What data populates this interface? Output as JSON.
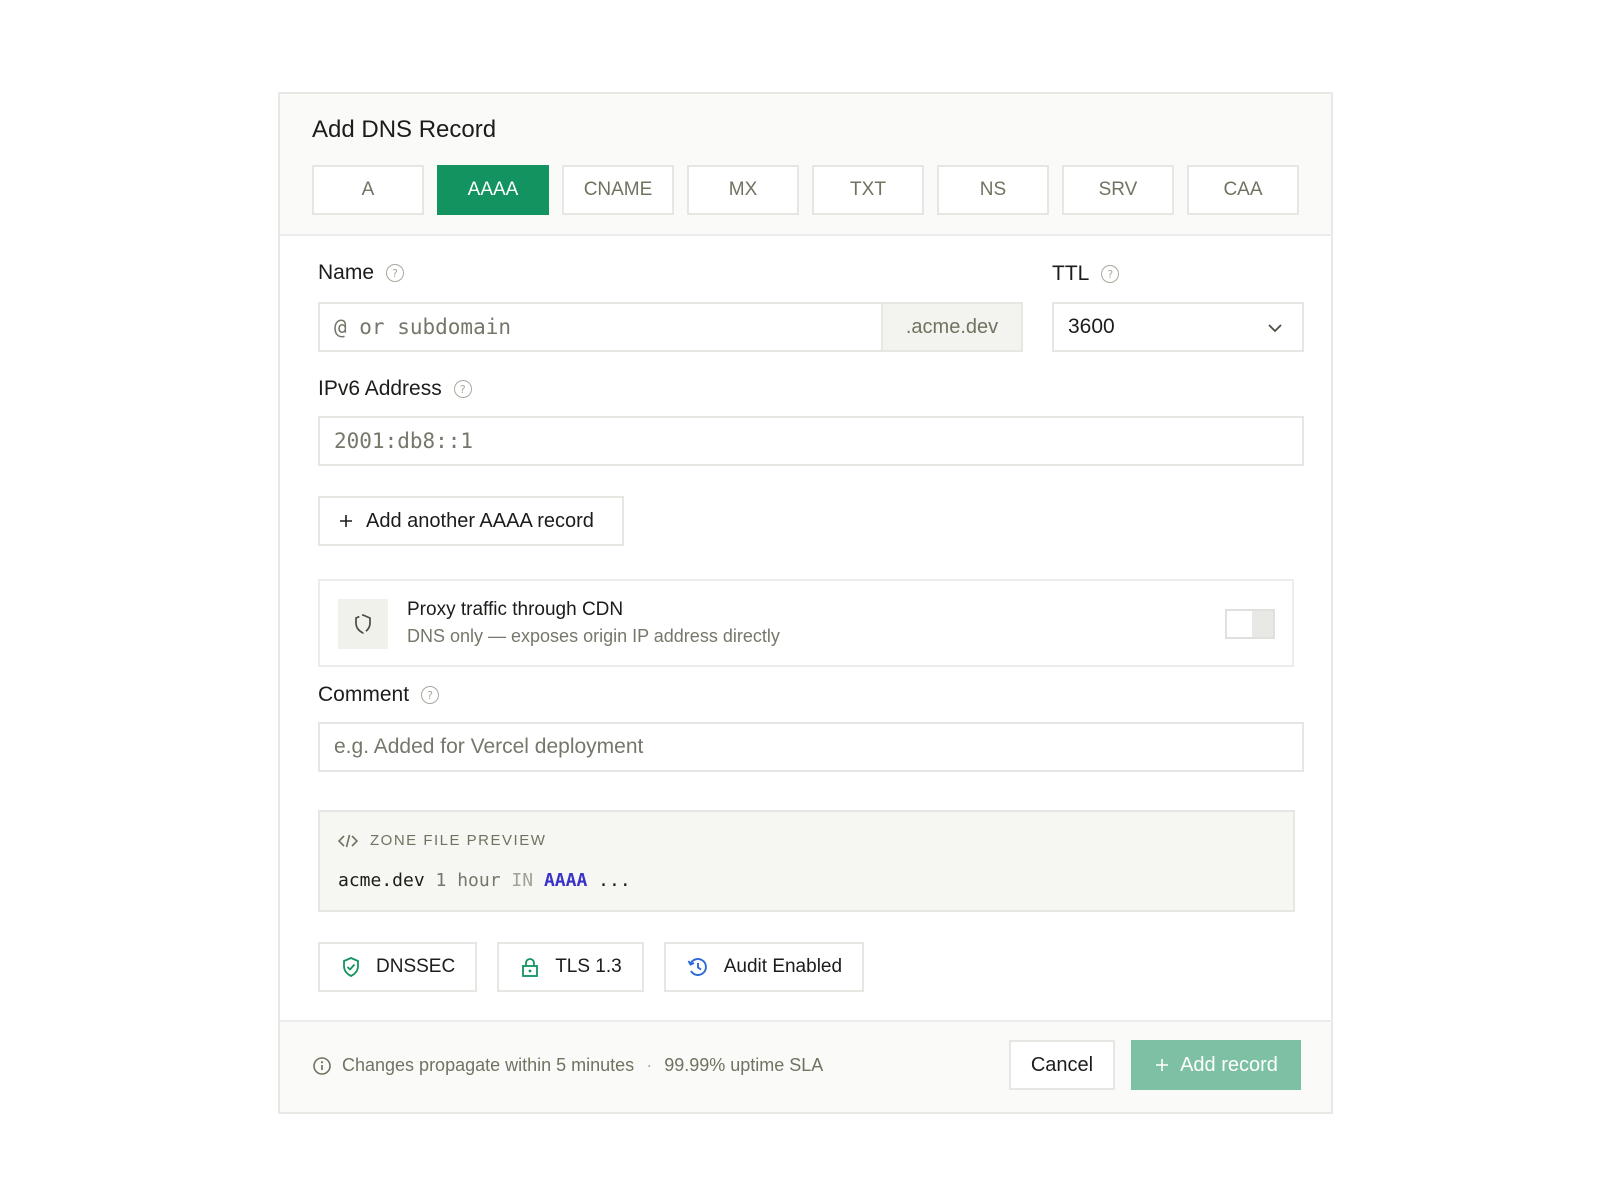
{
  "dialog": {
    "title": "Add DNS Record",
    "record_types": [
      "A",
      "AAAA",
      "CNAME",
      "MX",
      "TXT",
      "NS",
      "SRV",
      "CAA"
    ],
    "active_type": "AAAA"
  },
  "name_field": {
    "label": "Name",
    "placeholder": "@ or subdomain",
    "suffix": ".acme.dev"
  },
  "ttl_field": {
    "label": "TTL",
    "value": "3600"
  },
  "ipv6_field": {
    "label": "IPv6 Address",
    "placeholder": "2001:db8::1"
  },
  "add_another": {
    "label": "Add another AAAA record"
  },
  "proxy": {
    "title": "Proxy traffic through CDN",
    "subtitle": "DNS only — exposes origin IP address directly",
    "enabled": false
  },
  "comment_field": {
    "label": "Comment",
    "placeholder": "e.g. Added for Vercel deployment"
  },
  "zone_preview": {
    "heading": "ZONE FILE PREVIEW",
    "host": "acme.dev",
    "ttl": "1 hour",
    "class": "IN",
    "type": "AAAA",
    "rest": "..."
  },
  "badges": [
    {
      "label": "DNSSEC",
      "icon": "shield-check-icon",
      "color": "#12935f"
    },
    {
      "label": "TLS 1.3",
      "icon": "lock-icon",
      "color": "#12935f"
    },
    {
      "label": "Audit Enabled",
      "icon": "history-icon",
      "color": "#2c6ad6"
    }
  ],
  "footer": {
    "info_text": "Changes propagate within 5 minutes",
    "sla_text": "99.99% uptime SLA",
    "cancel_label": "Cancel",
    "submit_label": "Add record"
  },
  "colors": {
    "accent": "#12935f",
    "submit_disabled": "#7dc0a4",
    "record_type_highlight": "#3a32c6"
  }
}
